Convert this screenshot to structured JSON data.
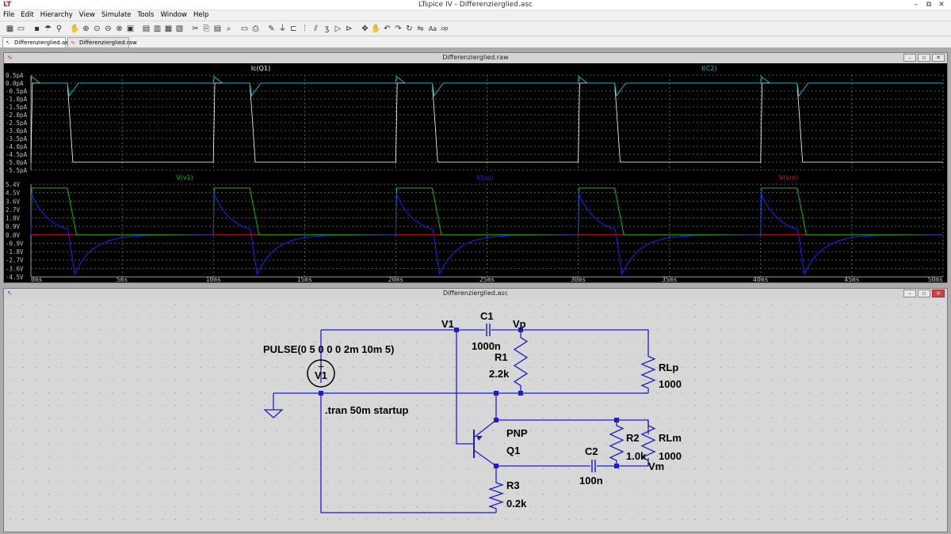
{
  "app": {
    "title": "LTspice IV - Differenzierglied.asc",
    "logo": "LT",
    "window_buttons": [
      "–",
      "⧉",
      "✕"
    ]
  },
  "menu": [
    "File",
    "Edit",
    "Hierarchy",
    "View",
    "Simulate",
    "Tools",
    "Window",
    "Help"
  ],
  "toolbar": {
    "icons": [
      "new-schematic-icon",
      "open-icon",
      "save-icon",
      "control-panel-icon",
      "run-icon",
      "halt-icon",
      "zoom-in-icon",
      "zoom-pan-icon",
      "zoom-out-icon",
      "zoom-cancel-icon",
      "autorange-icon",
      "fit-icon",
      "tile-horizontal-icon",
      "tile-vertical-icon",
      "cascade-icon",
      "cut-icon",
      "copy-icon",
      "paste-icon",
      "find-icon",
      "print-setup-icon",
      "print-icon",
      "draw-wire-icon",
      "ground-icon",
      "label-net-icon",
      "resistor-icon",
      "capacitor-icon",
      "inductor-icon",
      "diode-icon",
      "component-icon",
      "move-icon",
      "drag-icon",
      "undo-icon",
      "redo-icon",
      "rotate-icon",
      "mirror-icon",
      "text-icon",
      "spice-directive-icon"
    ],
    "text_label": "Aa",
    "op_label": ".op"
  },
  "tabs": [
    {
      "label": "Differenzierglied.asc",
      "active": true
    },
    {
      "label": "Differenzierglied.raw",
      "active": false
    }
  ],
  "waveform_window": {
    "title": "Differenzierglied.raw",
    "top_pane": {
      "traces": [
        {
          "name": "Ic(Q1)",
          "color": "#ffffff"
        },
        {
          "name": "I(C2)",
          "color": "#00c0c0"
        }
      ],
      "y_ticks": [
        "0.5pA",
        "0.0pA",
        "-0.5pA",
        "-1.0pA",
        "-1.5pA",
        "-2.0pA",
        "-2.5pA",
        "-3.0pA",
        "-3.5pA",
        "-4.0pA",
        "-4.5pA",
        "-5.0pA",
        "-5.5pA"
      ]
    },
    "bottom_pane": {
      "traces": [
        {
          "name": "V(v1)",
          "color": "#00c000"
        },
        {
          "name": "V(vp)",
          "color": "#2020ff"
        },
        {
          "name": "V(vm)",
          "color": "#ff0000"
        }
      ],
      "y_ticks": [
        "5.4V",
        "4.5V",
        "3.6V",
        "2.7V",
        "1.8V",
        "0.9V",
        "0.0V",
        "-0.9V",
        "-1.8V",
        "-2.7V",
        "-3.6V",
        "-4.5V"
      ]
    },
    "x_ticks": [
      "0ms",
      "5ms",
      "10ms",
      "15ms",
      "20ms",
      "25ms",
      "30ms",
      "35ms",
      "40ms",
      "45ms",
      "50ms"
    ],
    "colors": {
      "background": "#000000",
      "grid": "#5a5a5a",
      "axis_text": "#c0c0c0"
    }
  },
  "schematic_window": {
    "title": "Differenzierglied.asc",
    "labels": {
      "pulse": "PULSE(0 5 0 0 0 2m 10m 5)",
      "v1_ref": "V1",
      "v1_net": "V1",
      "c1_ref": "C1",
      "c1_val": "1000n",
      "vp": "Vp",
      "r1_ref": "R1",
      "r1_val": "2.2k",
      "rlp_ref": "RLp",
      "rlp_val": "1000",
      "tran": ".tran 50m startup",
      "q_type": "PNP",
      "q_ref": "Q1",
      "c2_ref": "C2",
      "c2_val": "100n",
      "r2_ref": "R2",
      "r2_val": "1.0k",
      "rlm_ref": "RLm",
      "rlm_val": "1000",
      "vm": "Vm",
      "r3_ref": "R3",
      "r3_val": "0.2k"
    },
    "colors": {
      "background": "#d7d7d7",
      "wire": "#1e1ec8",
      "component": "#1e1ec8",
      "node": "#1e1ec8",
      "text": "#000000"
    }
  }
}
